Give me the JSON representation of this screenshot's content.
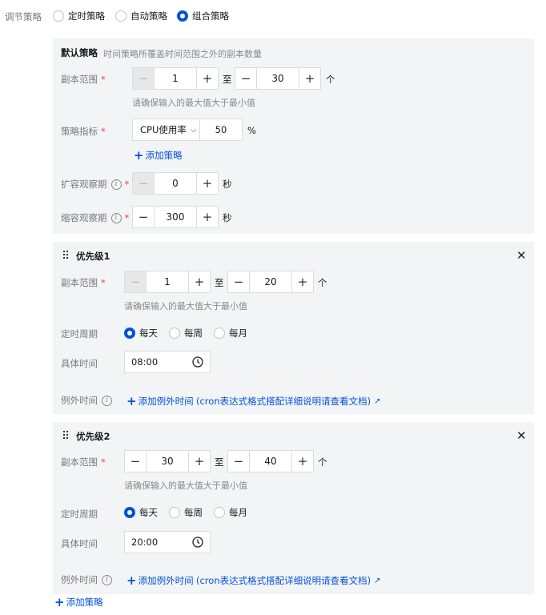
{
  "strategy": {
    "label": "调节策略",
    "options": [
      "定时策略",
      "自动策略",
      "组合策略"
    ],
    "selected": "组合策略"
  },
  "default_policy": {
    "title": "默认策略",
    "description": "时间策略所覆盖时间范围之外的副本数量",
    "replica_range": {
      "label": "副本范围",
      "min": "1",
      "max": "30",
      "to": "至",
      "unit": "个",
      "hint": "请确保输入的最大值大于最小值"
    },
    "metric": {
      "label": "策略指标",
      "selected": "CPU使用率",
      "value": "50",
      "unit": "%"
    },
    "add_policy": "添加策略",
    "scale_up": {
      "label": "扩容观察期",
      "value": "0",
      "unit": "秒"
    },
    "scale_down": {
      "label": "缩容观察期",
      "value": "300",
      "unit": "秒"
    }
  },
  "priorities": [
    {
      "title": "优先级1",
      "replica_range": {
        "label": "副本范围",
        "min": "1",
        "max": "20",
        "to": "至",
        "unit": "个",
        "hint": "请确保输入的最大值大于最小值"
      },
      "period": {
        "label": "定时周期",
        "options": [
          "每天",
          "每周",
          "每月"
        ],
        "selected": "每天"
      },
      "time": {
        "label": "具体时间",
        "value": "08:00"
      },
      "exception": {
        "label": "例外时间",
        "add": "添加例外时间",
        "doc": "(cron表达式格式搭配详细说明请查看文档)"
      }
    },
    {
      "title": "优先级2",
      "replica_range": {
        "label": "副本范围",
        "min": "30",
        "max": "40",
        "to": "至",
        "unit": "个",
        "hint": "请确保输入的最大值大于最小值"
      },
      "period": {
        "label": "定时周期",
        "options": [
          "每天",
          "每周",
          "每月"
        ],
        "selected": "每天"
      },
      "time": {
        "label": "具体时间",
        "value": "20:00"
      },
      "exception": {
        "label": "例外时间",
        "add": "添加例外时间",
        "doc": "(cron表达式格式搭配详细说明请查看文档)"
      }
    }
  ],
  "add_policy_bottom": "添加策略",
  "colors": {
    "accent": "#0052d9",
    "required": "#e54545",
    "panel": "#f3f4f6"
  }
}
